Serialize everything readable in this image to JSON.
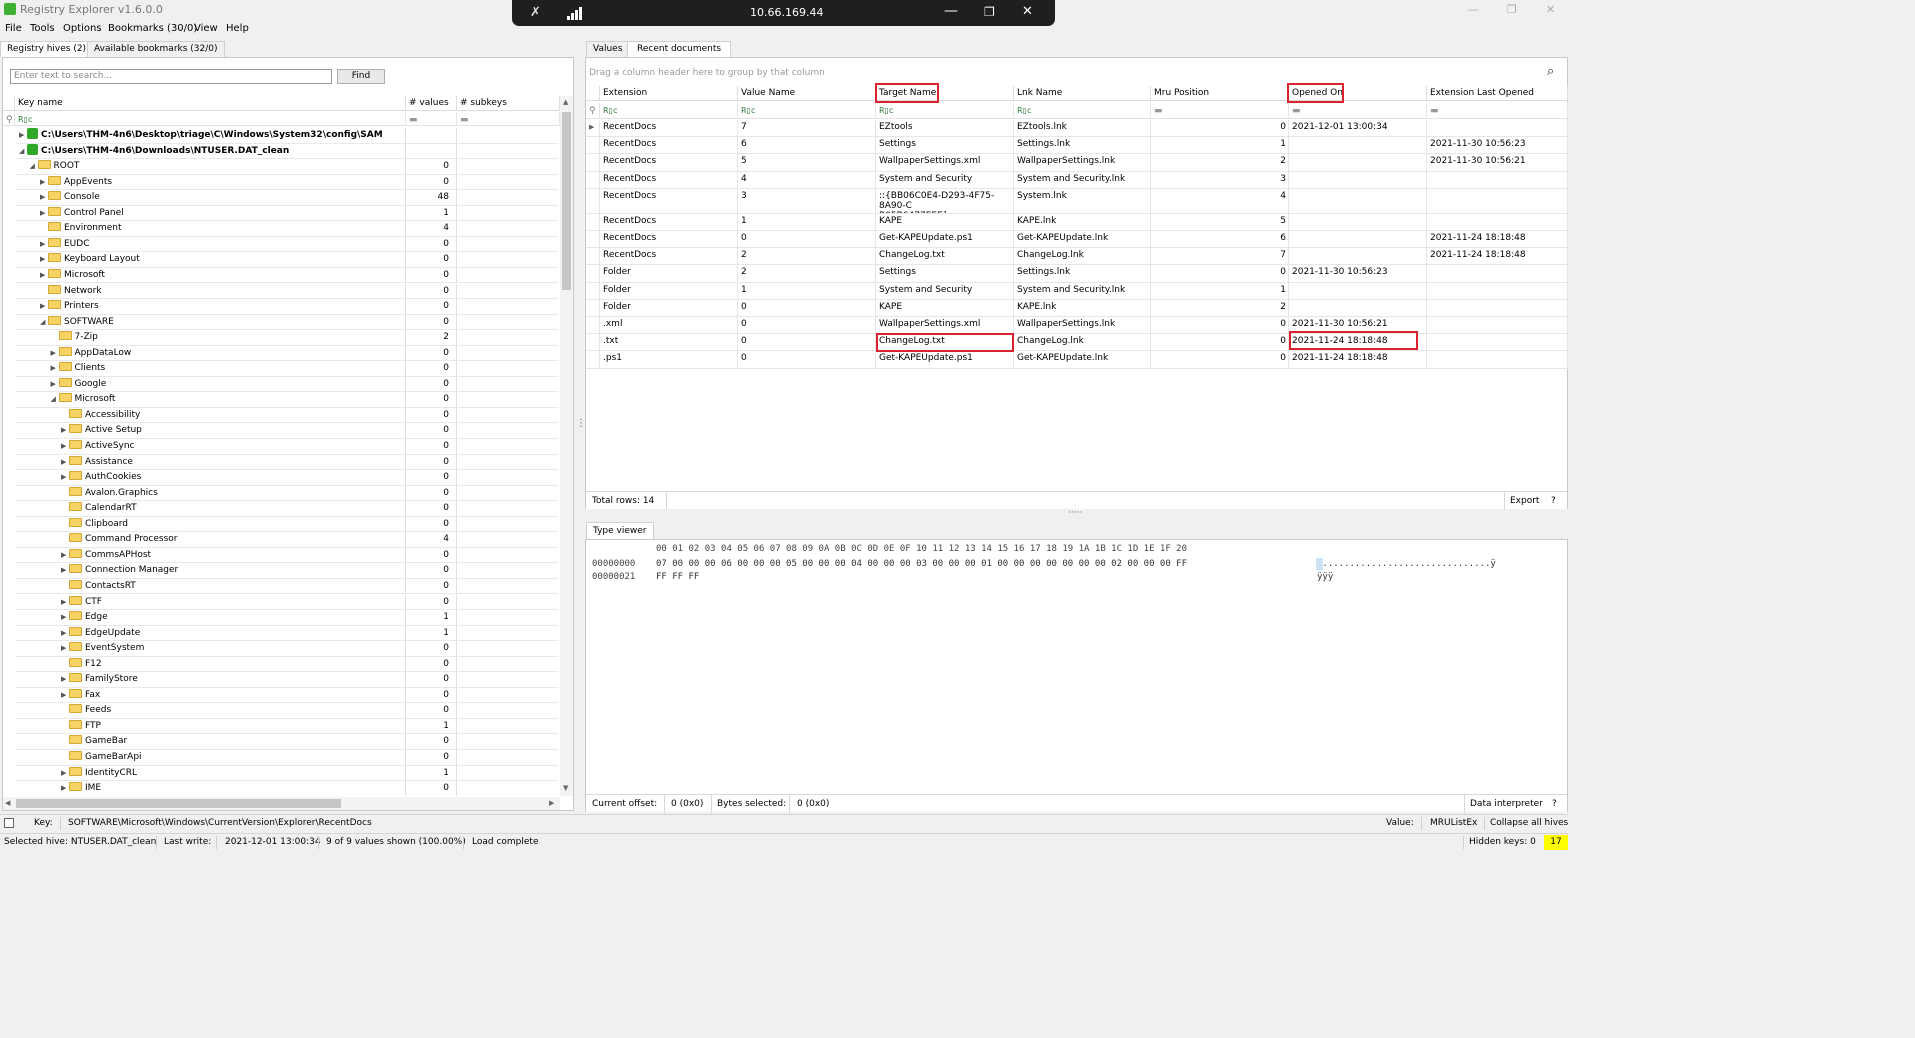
{
  "window": {
    "title": "Registry Explorer v1.6.0.0",
    "remote_ip": "10.66.169.44"
  },
  "menu": [
    "File",
    "Tools",
    "Options",
    "Bookmarks (30/0)",
    "View",
    "Help"
  ],
  "left_tabs": [
    "Registry hives (2)",
    "Available bookmarks (32/0)"
  ],
  "search": {
    "placeholder": "Enter text to search...",
    "find_label": "Find"
  },
  "tree_columns": {
    "key_name": "Key name",
    "values": "# values",
    "subkeys": "# subkeys"
  },
  "filter_glyph": "R▯c",
  "tree": [
    {
      "name": "C:\\Users\\THM-4n6\\Desktop\\triage\\C\\Windows\\System32\\config\\SAM",
      "depth": 0,
      "expander": "closed",
      "type": "hive",
      "values": ""
    },
    {
      "name": "C:\\Users\\THM-4n6\\Downloads\\NTUSER.DAT_clean",
      "depth": 0,
      "expander": "open",
      "type": "hive",
      "values": ""
    },
    {
      "name": "ROOT",
      "depth": 1,
      "expander": "open",
      "type": "folder",
      "values": "0"
    },
    {
      "name": "AppEvents",
      "depth": 2,
      "expander": "closed",
      "type": "folder",
      "values": "0"
    },
    {
      "name": "Console",
      "depth": 2,
      "expander": "closed",
      "type": "folder",
      "values": "48"
    },
    {
      "name": "Control Panel",
      "depth": 2,
      "expander": "closed",
      "type": "folder",
      "values": "1"
    },
    {
      "name": "Environment",
      "depth": 2,
      "expander": "none",
      "type": "folder",
      "values": "4"
    },
    {
      "name": "EUDC",
      "depth": 2,
      "expander": "closed",
      "type": "folder",
      "values": "0"
    },
    {
      "name": "Keyboard Layout",
      "depth": 2,
      "expander": "closed",
      "type": "folder",
      "values": "0"
    },
    {
      "name": "Microsoft",
      "depth": 2,
      "expander": "closed",
      "type": "folder",
      "values": "0"
    },
    {
      "name": "Network",
      "depth": 2,
      "expander": "none",
      "type": "folder",
      "values": "0"
    },
    {
      "name": "Printers",
      "depth": 2,
      "expander": "closed",
      "type": "folder",
      "values": "0"
    },
    {
      "name": "SOFTWARE",
      "depth": 2,
      "expander": "open",
      "type": "folder",
      "values": "0"
    },
    {
      "name": "7-Zip",
      "depth": 3,
      "expander": "none",
      "type": "folder",
      "values": "2"
    },
    {
      "name": "AppDataLow",
      "depth": 3,
      "expander": "closed",
      "type": "folder",
      "values": "0"
    },
    {
      "name": "Clients",
      "depth": 3,
      "expander": "closed",
      "type": "folder",
      "values": "0"
    },
    {
      "name": "Google",
      "depth": 3,
      "expander": "closed",
      "type": "folder",
      "values": "0"
    },
    {
      "name": "Microsoft",
      "depth": 3,
      "expander": "open",
      "type": "folder",
      "values": "0"
    },
    {
      "name": "Accessibility",
      "depth": 4,
      "expander": "none",
      "type": "folder",
      "values": "0"
    },
    {
      "name": "Active Setup",
      "depth": 4,
      "expander": "closed",
      "type": "folder",
      "values": "0"
    },
    {
      "name": "ActiveSync",
      "depth": 4,
      "expander": "closed",
      "type": "folder",
      "values": "0"
    },
    {
      "name": "Assistance",
      "depth": 4,
      "expander": "closed",
      "type": "folder",
      "values": "0"
    },
    {
      "name": "AuthCookies",
      "depth": 4,
      "expander": "closed",
      "type": "folder",
      "values": "0"
    },
    {
      "name": "Avalon.Graphics",
      "depth": 4,
      "expander": "none",
      "type": "folder",
      "values": "0"
    },
    {
      "name": "CalendarRT",
      "depth": 4,
      "expander": "none",
      "type": "folder",
      "values": "0"
    },
    {
      "name": "Clipboard",
      "depth": 4,
      "expander": "none",
      "type": "folder",
      "values": "0"
    },
    {
      "name": "Command Processor",
      "depth": 4,
      "expander": "none",
      "type": "folder",
      "values": "4"
    },
    {
      "name": "CommsAPHost",
      "depth": 4,
      "expander": "closed",
      "type": "folder",
      "values": "0"
    },
    {
      "name": "Connection Manager",
      "depth": 4,
      "expander": "closed",
      "type": "folder",
      "values": "0"
    },
    {
      "name": "ContactsRT",
      "depth": 4,
      "expander": "none",
      "type": "folder",
      "values": "0"
    },
    {
      "name": "CTF",
      "depth": 4,
      "expander": "closed",
      "type": "folder",
      "values": "0"
    },
    {
      "name": "Edge",
      "depth": 4,
      "expander": "closed",
      "type": "folder",
      "values": "1"
    },
    {
      "name": "EdgeUpdate",
      "depth": 4,
      "expander": "closed",
      "type": "folder",
      "values": "1"
    },
    {
      "name": "EventSystem",
      "depth": 4,
      "expander": "closed",
      "type": "folder",
      "values": "0"
    },
    {
      "name": "F12",
      "depth": 4,
      "expander": "none",
      "type": "folder",
      "values": "0"
    },
    {
      "name": "FamilyStore",
      "depth": 4,
      "expander": "closed",
      "type": "folder",
      "values": "0"
    },
    {
      "name": "Fax",
      "depth": 4,
      "expander": "closed",
      "type": "folder",
      "values": "0"
    },
    {
      "name": "Feeds",
      "depth": 4,
      "expander": "none",
      "type": "folder",
      "values": "0"
    },
    {
      "name": "FTP",
      "depth": 4,
      "expander": "none",
      "type": "folder",
      "values": "1"
    },
    {
      "name": "GameBar",
      "depth": 4,
      "expander": "none",
      "type": "folder",
      "values": "0"
    },
    {
      "name": "GameBarApi",
      "depth": 4,
      "expander": "none",
      "type": "folder",
      "values": "0"
    },
    {
      "name": "IdentityCRL",
      "depth": 4,
      "expander": "closed",
      "type": "folder",
      "values": "1"
    },
    {
      "name": "IME",
      "depth": 4,
      "expander": "closed",
      "type": "folder",
      "values": "0"
    }
  ],
  "right_tabs": [
    "Values",
    "Recent documents"
  ],
  "group_hint": "Drag a column header here to group by that column",
  "grid_columns": [
    "Extension",
    "Value Name",
    "Target Name",
    "Lnk Name",
    "Mru Position",
    "Opened On",
    "Extension Last Opened"
  ],
  "grid_rows": [
    [
      "RecentDocs",
      "7",
      "EZtools",
      "EZtools.lnk",
      "0",
      "2021-12-01 13:00:34",
      ""
    ],
    [
      "RecentDocs",
      "6",
      "Settings",
      "Settings.lnk",
      "1",
      "",
      "2021-11-30 10:56:23"
    ],
    [
      "RecentDocs",
      "5",
      "WallpaperSettings.xml",
      "WallpaperSettings.lnk",
      "2",
      "",
      "2021-11-30 10:56:21"
    ],
    [
      "RecentDocs",
      "4",
      "System and Security",
      "System and Security.lnk",
      "3",
      "",
      ""
    ],
    [
      "RecentDocs",
      "3",
      "::{BB06C0E4-D293-4F75-8A90-C\nB05B6477EEE}",
      "System.lnk",
      "4",
      "",
      ""
    ],
    [
      "RecentDocs",
      "1",
      "KAPE",
      "KAPE.lnk",
      "5",
      "",
      ""
    ],
    [
      "RecentDocs",
      "0",
      "Get-KAPEUpdate.ps1",
      "Get-KAPEUpdate.lnk",
      "6",
      "",
      "2021-11-24 18:18:48"
    ],
    [
      "RecentDocs",
      "2",
      "ChangeLog.txt",
      "ChangeLog.lnk",
      "7",
      "",
      "2021-11-24 18:18:48"
    ],
    [
      "Folder",
      "2",
      "Settings",
      "Settings.lnk",
      "0",
      "2021-11-30 10:56:23",
      ""
    ],
    [
      "Folder",
      "1",
      "System and Security",
      "System and Security.lnk",
      "1",
      "",
      ""
    ],
    [
      "Folder",
      "0",
      "KAPE",
      "KAPE.lnk",
      "2",
      "",
      ""
    ],
    [
      ".xml",
      "0",
      "WallpaperSettings.xml",
      "WallpaperSettings.lnk",
      "0",
      "2021-11-30 10:56:21",
      ""
    ],
    [
      ".txt",
      "0",
      "ChangeLog.txt",
      "ChangeLog.lnk",
      "0",
      "2021-11-24 18:18:48",
      ""
    ],
    [
      ".ps1",
      "0",
      "Get-KAPEUpdate.ps1",
      "Get-KAPEUpdate.lnk",
      "0",
      "2021-11-24 18:18:48",
      ""
    ]
  ],
  "grid_footer": {
    "total": "Total rows: 14",
    "export": "Export",
    "help": "?"
  },
  "type_viewer": {
    "tab": "Type viewer",
    "header": "00 01 02 03 04 05 06 07 08 09 0A 0B 0C 0D 0E 0F 10 11 12 13 14 15 16 17 18 19 1A 1B 1C 1D 1E 1F 20",
    "lines": [
      {
        "offset": "00000000",
        "hex": "07 00 00 00 06 00 00 00 05 00 00 00 04 00 00 00 03 00 00 00 01 00 00 00 00 00 00 00 02 00 00 00 FF",
        "ascii": "................................ÿ"
      },
      {
        "offset": "00000021",
        "hex": "FF FF FF",
        "ascii": "ÿÿÿ"
      }
    ],
    "current_offset_label": "Current offset:",
    "current_offset_value": "0 (0x0)",
    "bytes_selected_label": "Bytes selected:",
    "bytes_selected_value": "0 (0x0)",
    "data_interpreter": "Data interpreter",
    "help": "?"
  },
  "keybar": {
    "key_label": "Key:",
    "key_value": "SOFTWARE\\Microsoft\\Windows\\CurrentVersion\\Explorer\\RecentDocs",
    "value_label": "Value:",
    "value_value": "MRUListEx",
    "collapse": "Collapse all hives"
  },
  "status": {
    "selected_hive": "Selected hive: NTUSER.DAT_clean",
    "last_write_label": "Last write:",
    "last_write_value": "2021-12-01 13:00:34",
    "values_shown": "9 of 9 values shown (100.00%)",
    "load": "Load complete",
    "hidden_keys_label": "Hidden keys: 0",
    "hidden_keys_badge": "17"
  },
  "colors": {
    "highlight": "#d9232e",
    "hive_icon": "#2fa82a",
    "folder": "#f6d365",
    "badge": "#ffff00"
  }
}
